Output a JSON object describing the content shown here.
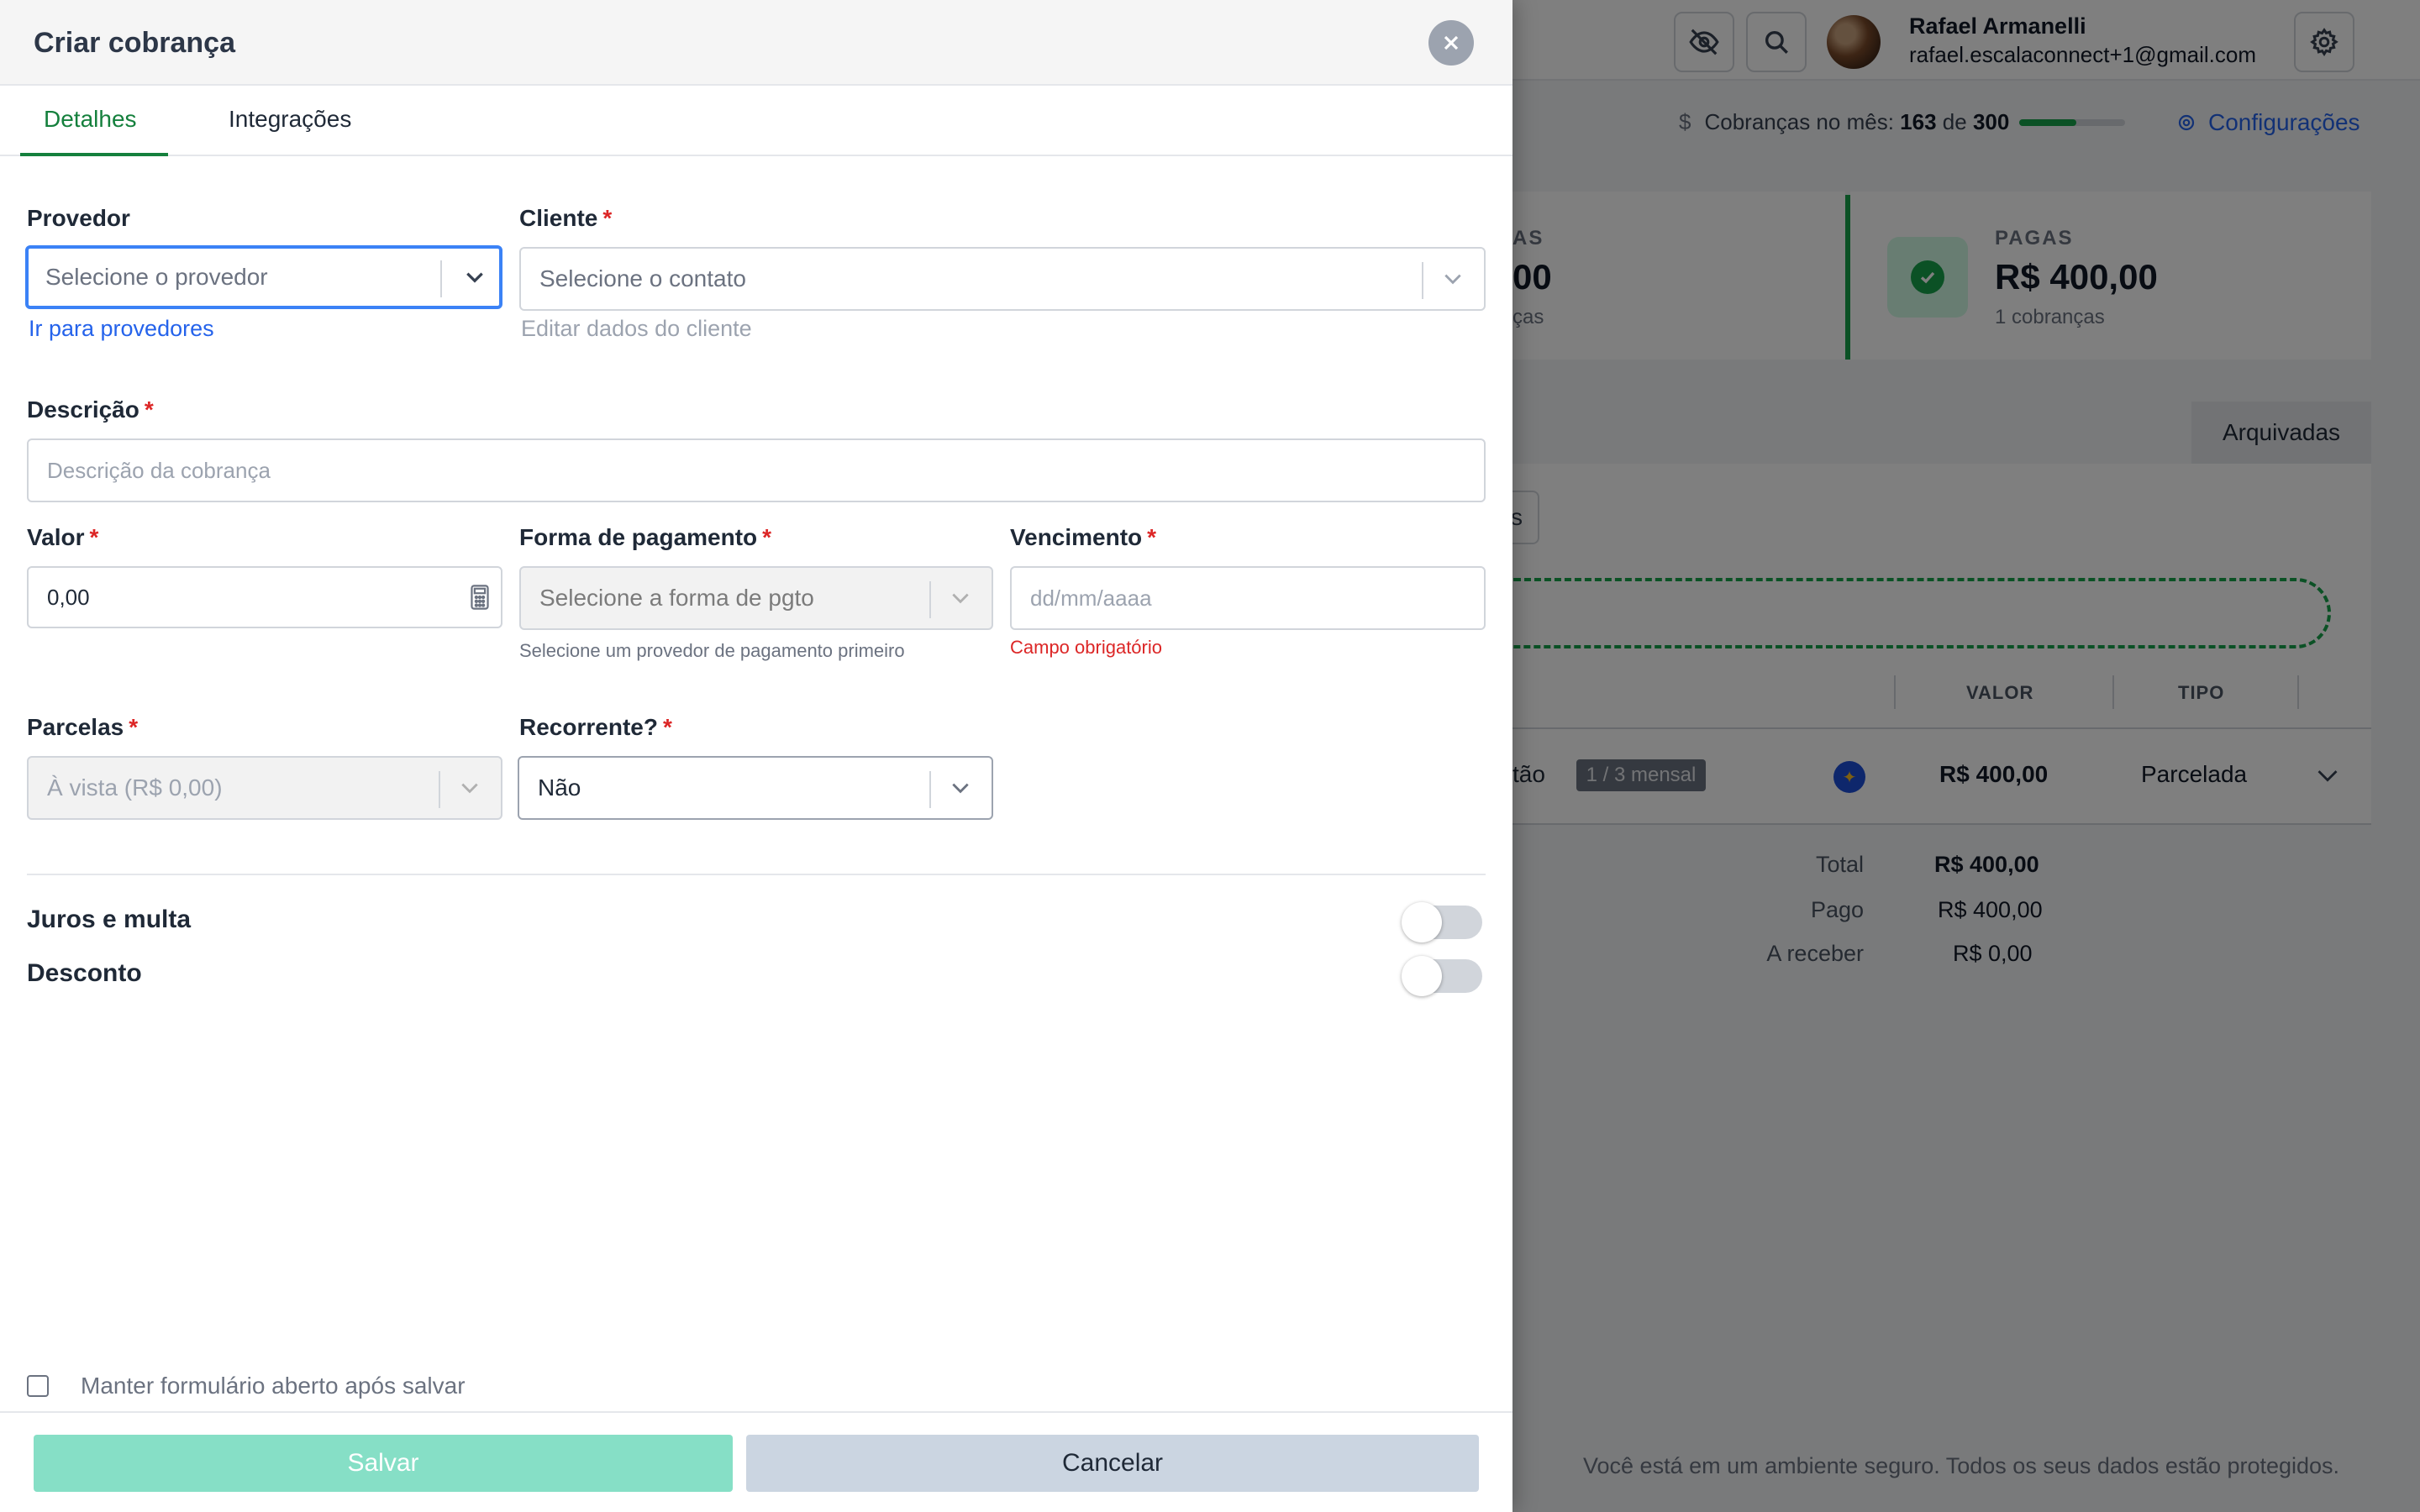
{
  "background": {
    "user": {
      "name": "Rafael Armanelli",
      "email": "rafael.escalaconnect+1@gmail.com"
    },
    "usage": {
      "currency_icon": "$",
      "label": "Cobranças no mês:",
      "used": "163",
      "of": "de",
      "total": "300",
      "fraction": 0.54
    },
    "config_label": "Configurações",
    "card_left": {
      "label_fragment": "AS",
      "value_fragment": "00",
      "count_fragment": "ças"
    },
    "card_paid": {
      "label": "PAGAS",
      "value": "R$ 400,00",
      "count": "1 cobranças"
    },
    "archived_tab": "Arquivadas",
    "filter_fragment": "s",
    "table": {
      "headers": [
        "VALOR",
        "TIPO"
      ],
      "row": {
        "text_fragment": "tão",
        "installment_badge": "1 / 3 mensal",
        "value": "R$ 400,00",
        "type": "Parcelada"
      }
    },
    "totals": [
      {
        "label": "Total",
        "value": "R$ 400,00"
      },
      {
        "label": "Pago",
        "value": "R$ 400,00"
      },
      {
        "label": "A receber",
        "value": "R$ 0,00"
      }
    ],
    "secure_note": "Você está em um ambiente seguro. Todos os seus dados estão protegidos.",
    "colors": {
      "accent_green": "#16a34a",
      "link_blue": "#2563eb"
    }
  },
  "drawer": {
    "title": "Criar cobrança",
    "tabs": [
      {
        "label": "Detalhes",
        "active": true
      },
      {
        "label": "Integrações",
        "active": false
      }
    ],
    "provider": {
      "label": "Provedor",
      "placeholder": "Selecione o provedor",
      "link": "Ir para provedores"
    },
    "client": {
      "label": "Cliente",
      "required": "*",
      "placeholder": "Selecione o contato",
      "link": "Editar dados do cliente"
    },
    "description": {
      "label": "Descrição",
      "required": "*",
      "placeholder": "Descrição da cobrança"
    },
    "value": {
      "label": "Valor",
      "required": "*",
      "value": "0,00"
    },
    "payment_method": {
      "label": "Forma de pagamento",
      "required": "*",
      "placeholder": "Selecione a forma de pgto",
      "help": "Selecione um provedor de pagamento primeiro"
    },
    "due_date": {
      "label": "Vencimento",
      "required": "*",
      "placeholder": "dd/mm/aaaa",
      "error": "Campo obrigatório"
    },
    "installments": {
      "label": "Parcelas",
      "required": "*",
      "value": "À vista (R$ 0,00)"
    },
    "recurring": {
      "label": "Recorrente?",
      "required": "*",
      "value": "Não"
    },
    "interest_toggle": {
      "label": "Juros e multa",
      "on": false
    },
    "discount_toggle": {
      "label": "Desconto",
      "on": false
    },
    "keep_open": {
      "label": "Manter formulário aberto após salvar",
      "checked": false
    },
    "save_label": "Salvar",
    "cancel_label": "Cancelar",
    "colors": {
      "active_tab": "#15803d",
      "focus_border": "#3b82f6",
      "required": "#dc2626",
      "save_button": "#86dfc6"
    }
  }
}
